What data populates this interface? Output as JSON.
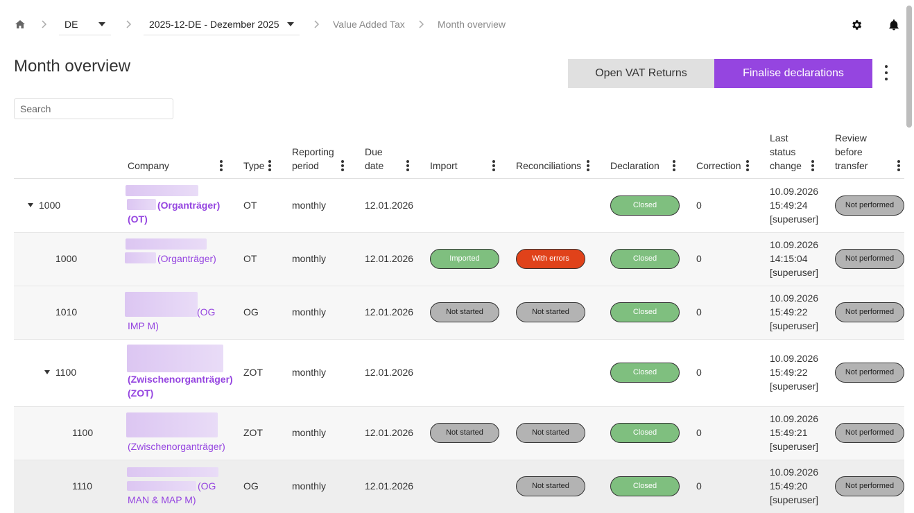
{
  "breadcrumb": {
    "country_value": "DE",
    "period_value": "2025-12-DE - Dezember 2025",
    "section": "Value Added Tax",
    "current": "Month overview"
  },
  "page": {
    "title": "Month overview",
    "open_label": "Open VAT Returns",
    "finalise_label": "Finalise declarations",
    "search_placeholder": "Search"
  },
  "table": {
    "headers": {
      "company": "Company",
      "type": "Type",
      "reporting_1": "Reporting",
      "reporting_2": "period",
      "due_1": "Due",
      "due_2": "date",
      "import": "Import",
      "reconciliations": "Reconciliations",
      "declaration": "Declaration",
      "correction": "Correction",
      "last_1": "Last",
      "last_2": "status",
      "last_3": "change",
      "review_1": "Review",
      "review_2": "before",
      "review_3": "transfer"
    },
    "rows": [
      {
        "id": "1000",
        "company_1": "(Organträger)",
        "company_2": "(OT)",
        "type": "OT",
        "period": "monthly",
        "due": "12.01.2026",
        "import": "",
        "recon": "",
        "declaration": "Closed",
        "correction": "0",
        "date": "10.09.2026",
        "time": "15:49:24",
        "user": "[superuser]",
        "review": "Not performed"
      },
      {
        "id": "1000",
        "company_1": "(Organträger)",
        "company_2": "",
        "type": "OT",
        "period": "monthly",
        "due": "12.01.2026",
        "import": "Imported",
        "recon": "With errors",
        "declaration": "Closed",
        "correction": "0",
        "date": "10.09.2026",
        "time": "14:15:04",
        "user": "[superuser]",
        "review": "Not performed"
      },
      {
        "id": "1010",
        "company_1": "(OG",
        "company_2": "IMP M)",
        "type": "OG",
        "period": "monthly",
        "due": "12.01.2026",
        "import": "Not started",
        "recon": "Not started",
        "declaration": "Closed",
        "correction": "0",
        "date": "10.09.2026",
        "time": "15:49:22",
        "user": "[superuser]",
        "review": "Not performed"
      },
      {
        "id": "1100",
        "company_1": "(Zwischenorganträger)",
        "company_2": "(ZOT)",
        "type": "ZOT",
        "period": "monthly",
        "due": "12.01.2026",
        "import": "",
        "recon": "",
        "declaration": "Closed",
        "correction": "0",
        "date": "10.09.2026",
        "time": "15:49:22",
        "user": "[superuser]",
        "review": "Not performed"
      },
      {
        "id": "1100",
        "company_1": "(Zwischenorganträger)",
        "company_2": "",
        "type": "ZOT",
        "period": "monthly",
        "due": "12.01.2026",
        "import": "Not started",
        "recon": "Not started",
        "declaration": "Closed",
        "correction": "0",
        "date": "10.09.2026",
        "time": "15:49:21",
        "user": "[superuser]",
        "review": "Not performed"
      },
      {
        "id": "1110",
        "company_1": "(OG",
        "company_2": "MAN & MAP M)",
        "type": "OG",
        "period": "monthly",
        "due": "12.01.2026",
        "import": "",
        "recon": "Not started",
        "declaration": "Closed",
        "correction": "0",
        "date": "10.09.2026",
        "time": "15:49:20",
        "user": "[superuser]",
        "review": "Not performed"
      }
    ]
  },
  "colors": {
    "accent": "#9545e0",
    "closed": "#7fbf7f",
    "error": "#e0421a",
    "neutral": "#b3b3b3"
  }
}
